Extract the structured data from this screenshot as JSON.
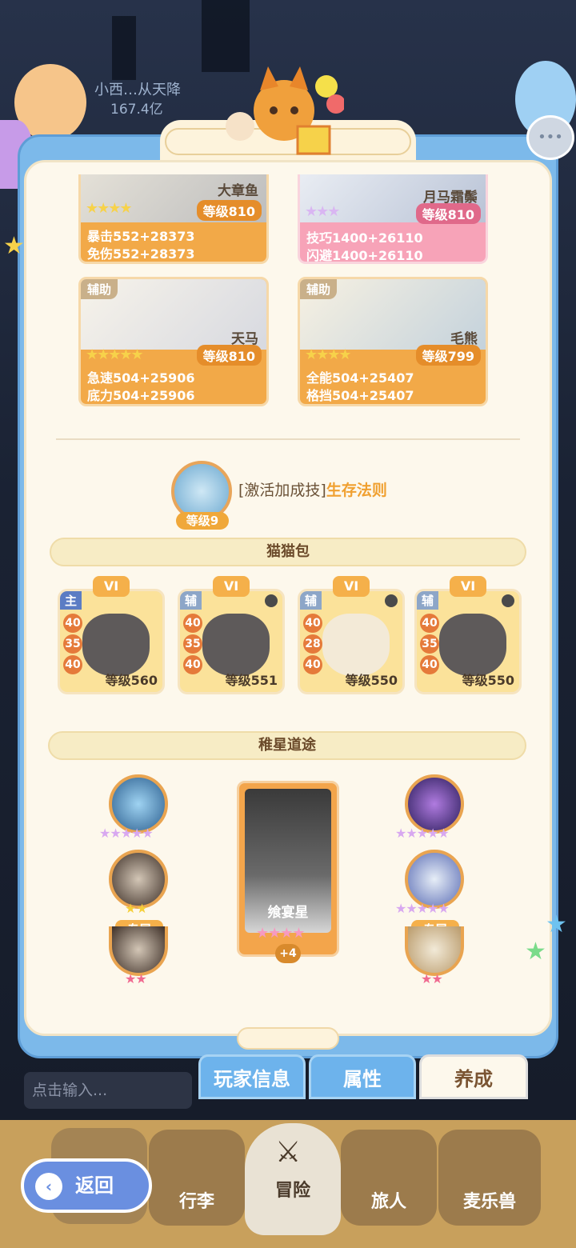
{
  "top": {
    "name": "小西…从天降",
    "value": "167.4亿"
  },
  "companions": [
    {
      "name": "大章鱼",
      "level": "等级810",
      "stars": "★★★★",
      "stat1": "暴击552+28373",
      "stat2": "免伤552+28373",
      "tag": ""
    },
    {
      "name": "月马霜鬃",
      "level": "等级810",
      "stars": "★★★",
      "stat1": "技巧1400+26110",
      "stat2": "闪避1400+26110",
      "tag": ""
    },
    {
      "name": "天马",
      "level": "等级810",
      "stars": "★★★★★",
      "stat1": "急速504+25906",
      "stat2": "底力504+25906",
      "tag": "辅助"
    },
    {
      "name": "毛熊",
      "level": "等级799",
      "stars": "★★★★",
      "stat1": "全能504+25407",
      "stat2": "格挡504+25407",
      "tag": "辅助"
    }
  ],
  "skill": {
    "level": "等级9",
    "prefix": "[激活加成技]",
    "name": "生存法则"
  },
  "cat_section": {
    "title": "猫猫包"
  },
  "cats": [
    {
      "rank": "VI",
      "role": "主",
      "stats": [
        "40",
        "35",
        "40"
      ],
      "level": "等级560"
    },
    {
      "rank": "VI",
      "role": "辅",
      "stats": [
        "40",
        "35",
        "40"
      ],
      "level": "等级551"
    },
    {
      "rank": "VI",
      "role": "辅",
      "stats": [
        "40",
        "28",
        "40"
      ],
      "level": "等级550"
    },
    {
      "rank": "VI",
      "role": "辅",
      "stats": [
        "40",
        "35",
        "40"
      ],
      "level": "等级550"
    }
  ],
  "star_section": {
    "title": "稚星道途"
  },
  "star_center": {
    "name": "飨宴星",
    "plus": "+4",
    "stars": "★★★★"
  },
  "left_orbs": {
    "stars1": "★★★★★",
    "stars2": "★★",
    "excl": "专属",
    "stars3": "★★"
  },
  "right_orbs": {
    "stars1": "★★★★★",
    "stars2": "★★★★★",
    "excl": "专属",
    "stars3": "★★"
  },
  "tabs": {
    "player_info": "玩家信息",
    "attributes": "属性",
    "development": "养成"
  },
  "input": {
    "placeholder": "点击输入..."
  },
  "nav": {
    "luggage": "行李",
    "adventure": "冒险",
    "traveler": "旅人",
    "pet": "麦乐兽"
  },
  "back": {
    "label": "返回"
  }
}
